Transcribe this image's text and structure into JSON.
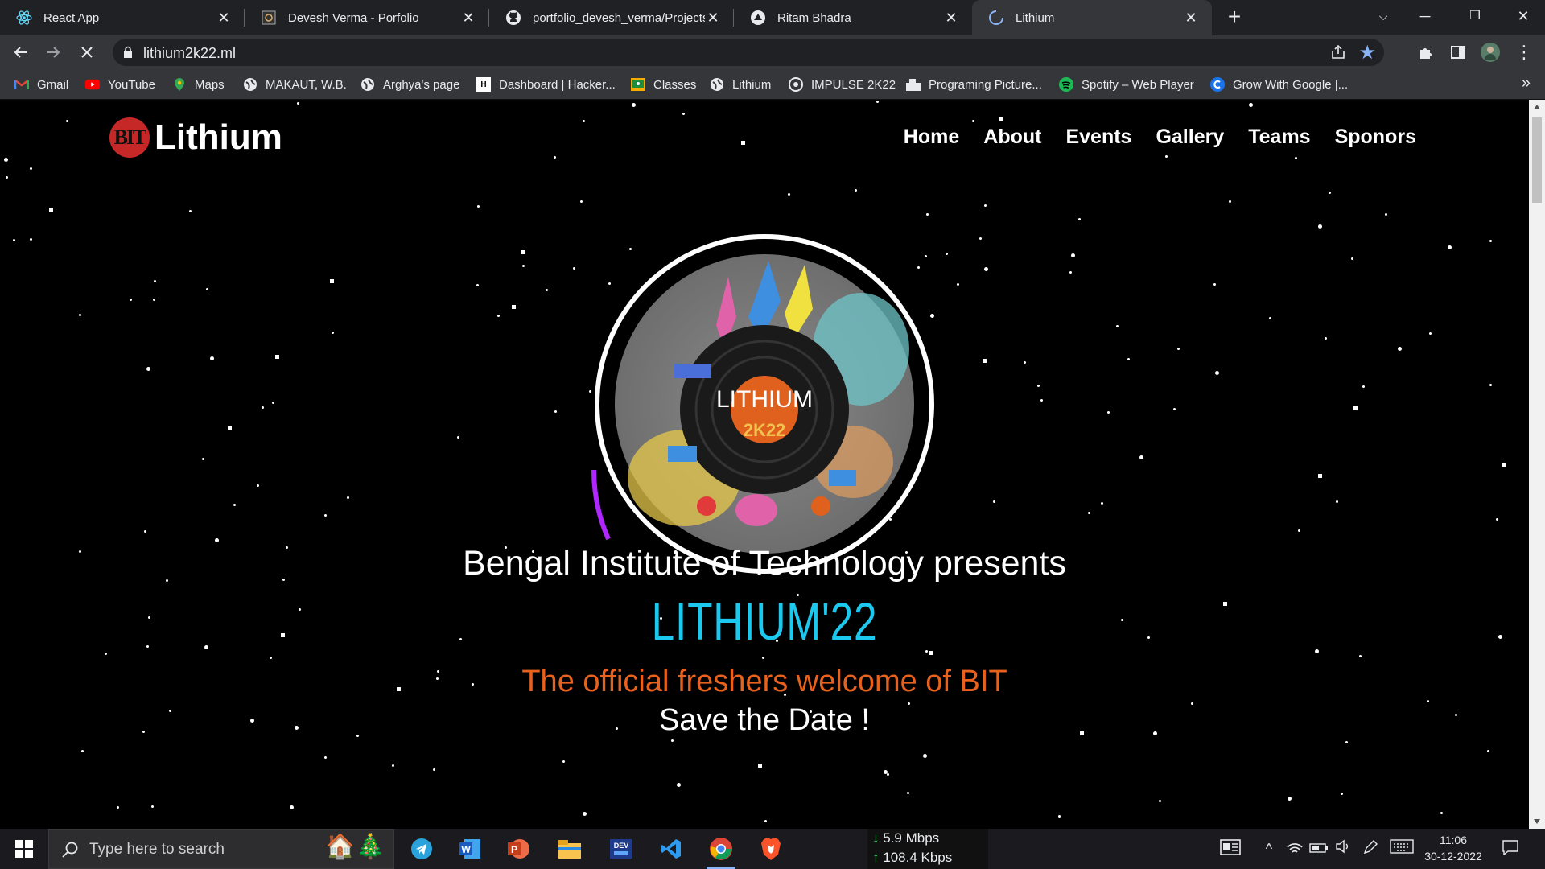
{
  "browser": {
    "tabs": [
      {
        "title": "React App",
        "favicon": "react-icon",
        "active": false
      },
      {
        "title": "Devesh Verma - Porfolio",
        "favicon": "portfolio-icon",
        "active": false
      },
      {
        "title": "portfolio_devesh_verma/Projects",
        "favicon": "github-icon",
        "active": false
      },
      {
        "title": "Ritam Bhadra",
        "favicon": "site-icon",
        "active": false
      },
      {
        "title": "Lithium",
        "favicon": "loading-spinner-icon",
        "active": true
      }
    ],
    "url": "lithium2k22.ml",
    "bookmarks": [
      {
        "label": "Gmail",
        "icon": "gmail-icon"
      },
      {
        "label": "YouTube",
        "icon": "youtube-icon"
      },
      {
        "label": "Maps",
        "icon": "maps-icon"
      },
      {
        "label": "MAKAUT, W.B.",
        "icon": "globe-icon"
      },
      {
        "label": "Arghya's page",
        "icon": "globe-icon"
      },
      {
        "label": "Dashboard | Hacker...",
        "icon": "hackerrank-icon"
      },
      {
        "label": "Classes",
        "icon": "classroom-icon"
      },
      {
        "label": "Lithium",
        "icon": "globe-icon"
      },
      {
        "label": "IMPULSE 2K22",
        "icon": "impulse-icon"
      },
      {
        "label": "Programing Picture...",
        "icon": "folder-icon"
      },
      {
        "label": "Spotify – Web Player",
        "icon": "spotify-icon"
      },
      {
        "label": "Grow With Google |...",
        "icon": "google-c-icon"
      }
    ]
  },
  "site": {
    "logo_badge": "BIT",
    "logo_text": "Lithium",
    "nav": [
      "Home",
      "About",
      "Events",
      "Gallery",
      "Teams",
      "Sponors"
    ],
    "emblem_title": "LITHIUM",
    "emblem_sub": "2K22",
    "presents": "Bengal Institute of Technology presents",
    "event_name": "LITHIUM'22",
    "tagline": "The official freshers welcome of BIT",
    "save_date": "Save the Date !",
    "colors": {
      "event_name": "#1cc8ee",
      "tagline": "#e8621e",
      "arc_top": "#1e9bff",
      "arc_bottom": "#b026ff"
    }
  },
  "taskbar": {
    "search_placeholder": "Type here to search",
    "apps": [
      "telegram-icon",
      "word-icon",
      "powerpoint-icon",
      "file-explorer-icon",
      "dev-icon",
      "vscode-icon",
      "chrome-icon",
      "brave-icon"
    ],
    "net_down": "5.9 Mbps",
    "net_up": "108.4 Kbps",
    "time": "11:06",
    "date": "30-12-2022"
  }
}
